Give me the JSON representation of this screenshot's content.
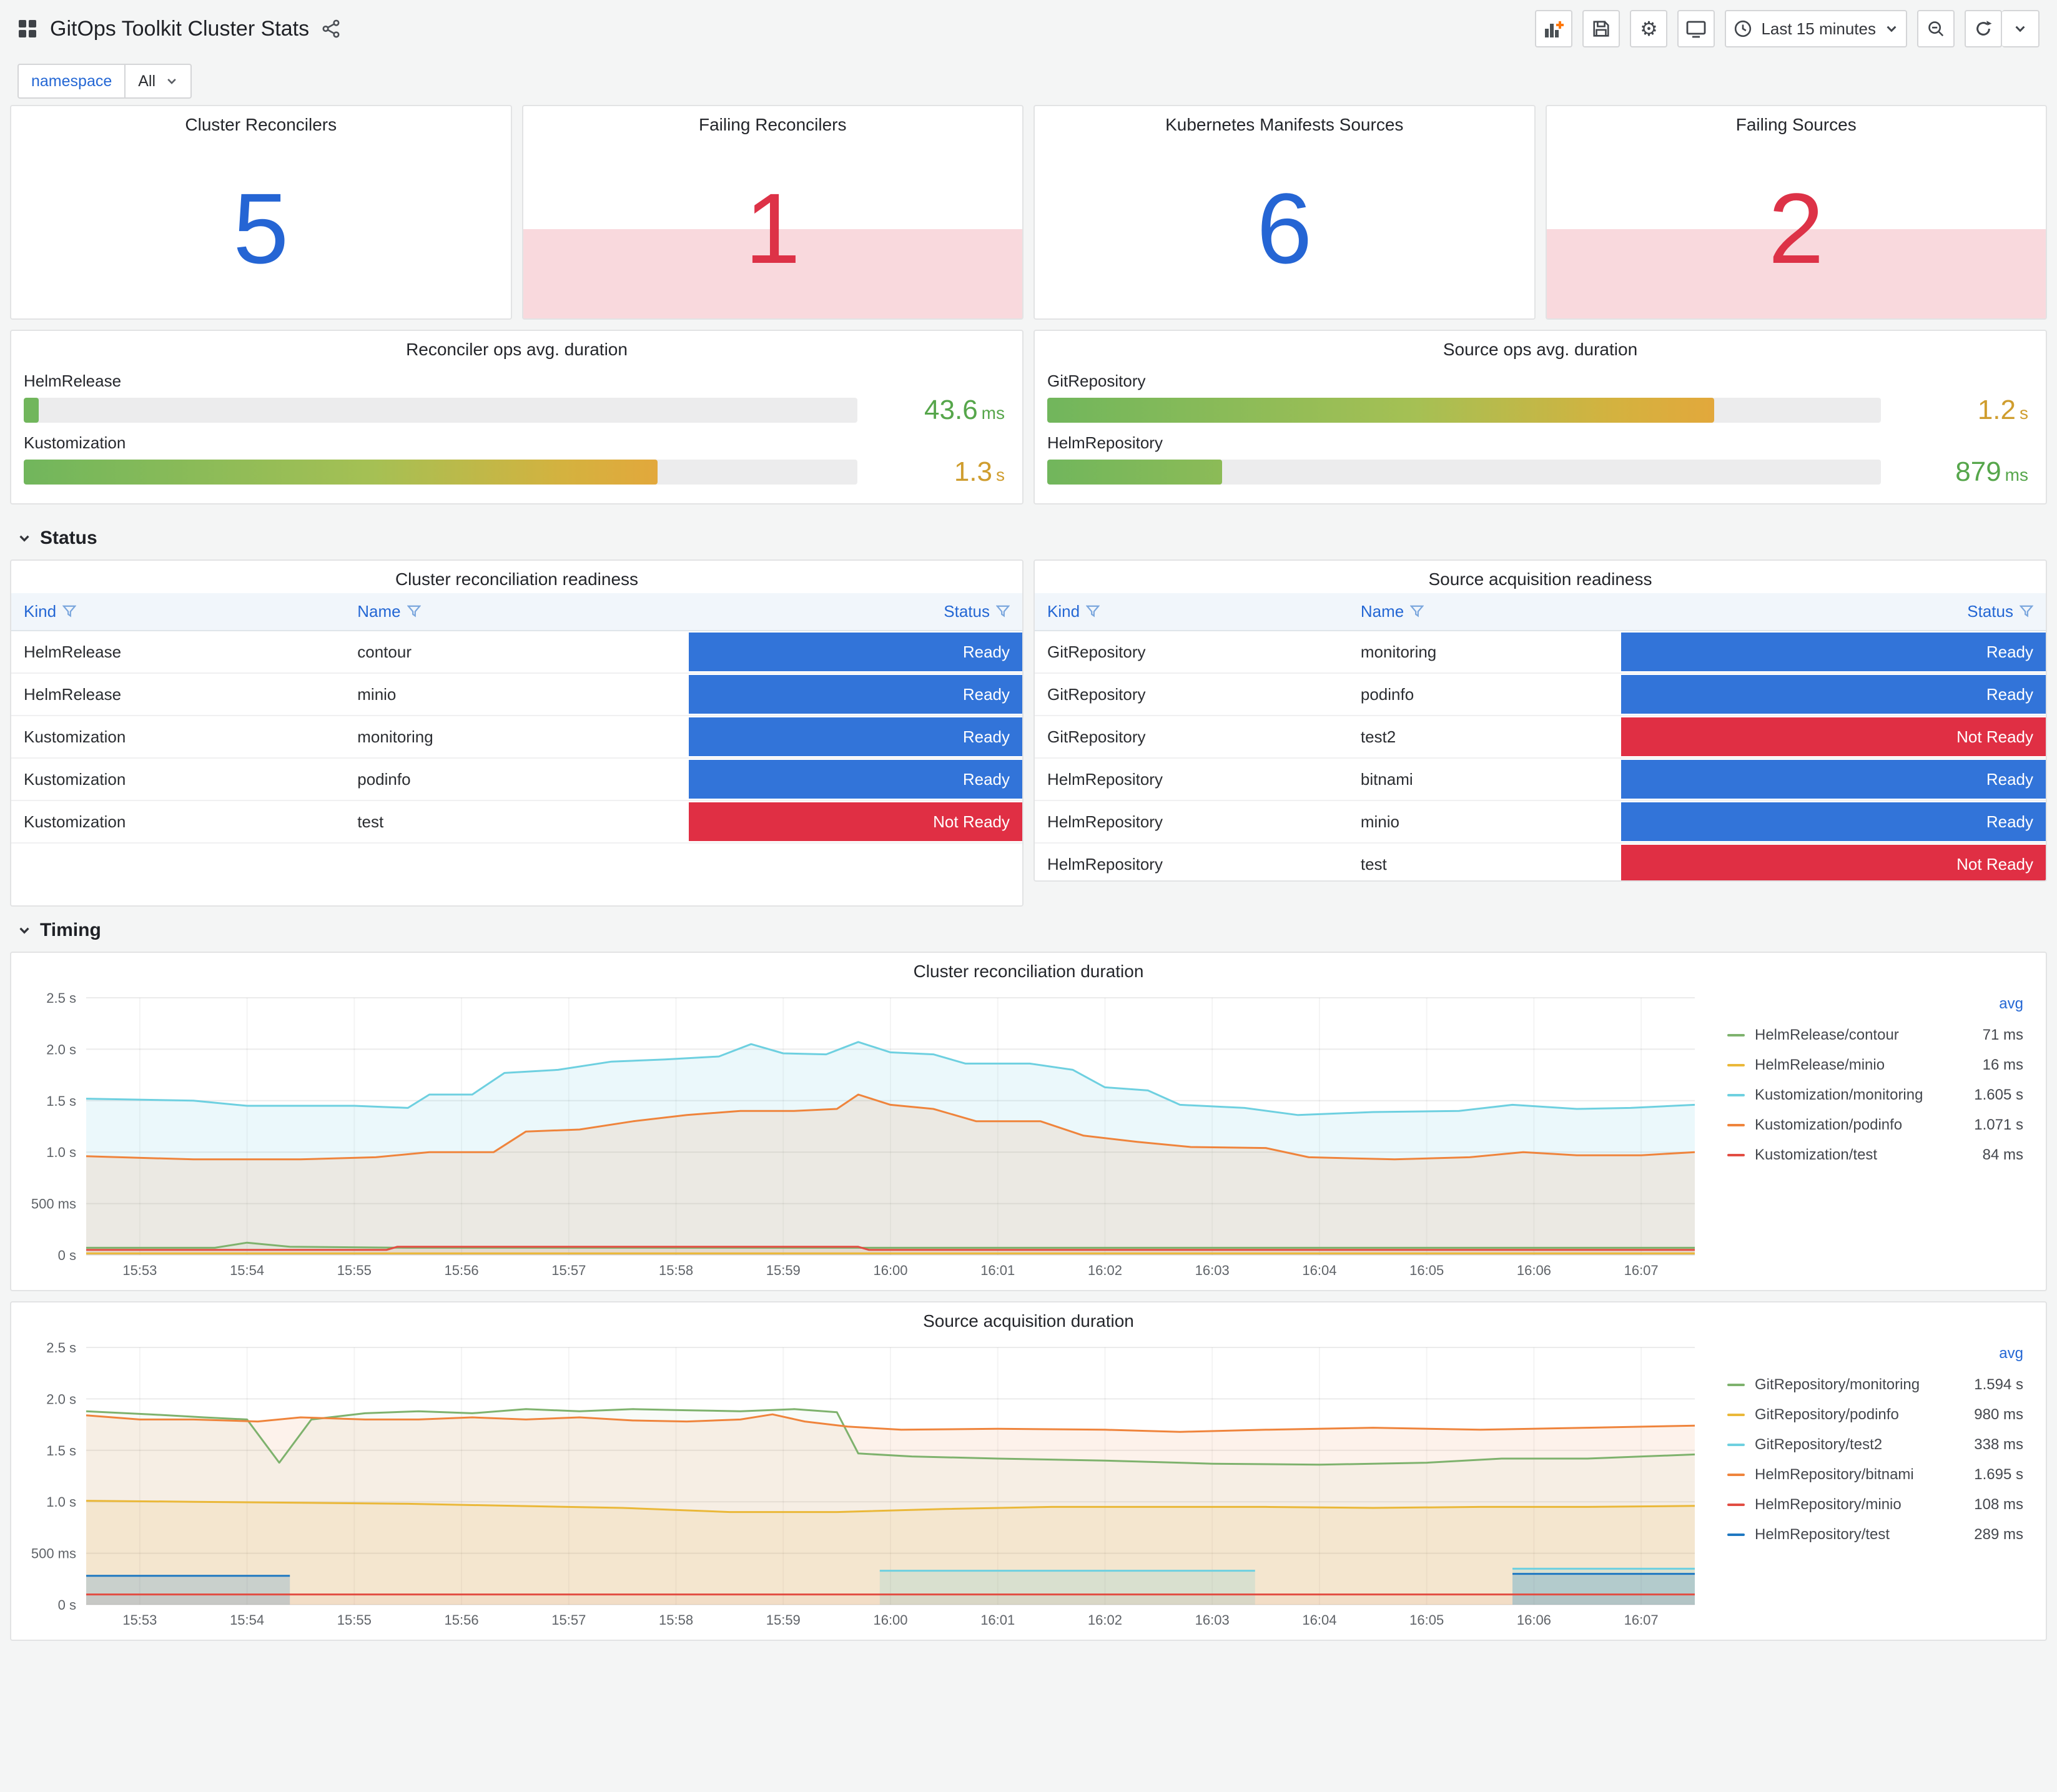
{
  "header": {
    "title": "GitOps Toolkit Cluster Stats",
    "time_label": "Last 15 minutes"
  },
  "filters": {
    "namespace_label": "namespace",
    "namespace_value": "All"
  },
  "sections": {
    "status": "Status",
    "timing": "Timing"
  },
  "stats": [
    {
      "title": "Cluster Reconcilers",
      "value": "5",
      "color": "#2565d4"
    },
    {
      "title": "Failing Reconcilers",
      "value": "1",
      "color": "#dd3247"
    },
    {
      "title": "Kubernetes Manifests Sources",
      "value": "6",
      "color": "#2565d4"
    },
    {
      "title": "Failing Sources",
      "value": "2",
      "color": "#dd3247"
    }
  ],
  "gauges": [
    {
      "title": "Reconciler ops avg. duration",
      "rows": [
        {
          "label": "HelmRelease",
          "value": "43.6",
          "unit": "ms",
          "width": "1.8%",
          "color": "#56a64b"
        },
        {
          "label": "Kustomization",
          "value": "1.3",
          "unit": "s",
          "width": "76%",
          "color": "#cf9d2e"
        }
      ]
    },
    {
      "title": "Source ops avg. duration",
      "rows": [
        {
          "label": "GitRepository",
          "value": "1.2",
          "unit": "s",
          "width": "80%",
          "color": "#cf9d2e"
        },
        {
          "label": "HelmRepository",
          "value": "879",
          "unit": "ms",
          "width": "21%",
          "color": "#56a64b"
        }
      ]
    }
  ],
  "status": {
    "tables": [
      {
        "title": "Cluster reconciliation readiness",
        "columns": [
          "Kind",
          "Name",
          "Status"
        ],
        "rows": [
          [
            "HelmRelease",
            "contour",
            "Ready"
          ],
          [
            "HelmRelease",
            "minio",
            "Ready"
          ],
          [
            "Kustomization",
            "monitoring",
            "Ready"
          ],
          [
            "Kustomization",
            "podinfo",
            "Ready"
          ],
          [
            "Kustomization",
            "test",
            "Not Ready"
          ]
        ]
      },
      {
        "title": "Source acquisition readiness",
        "columns": [
          "Kind",
          "Name",
          "Status"
        ],
        "rows": [
          [
            "GitRepository",
            "monitoring",
            "Ready"
          ],
          [
            "GitRepository",
            "podinfo",
            "Ready"
          ],
          [
            "GitRepository",
            "test2",
            "Not Ready"
          ],
          [
            "HelmRepository",
            "bitnami",
            "Ready"
          ],
          [
            "HelmRepository",
            "minio",
            "Ready"
          ],
          [
            "HelmRepository",
            "test",
            "Not Ready"
          ]
        ]
      }
    ]
  },
  "chart_data": [
    {
      "type": "line",
      "title": "Cluster reconciliation duration",
      "legend_header": "avg",
      "xlim": [
        0,
        15
      ],
      "ylim": [
        0,
        2.5
      ],
      "yticks": [
        {
          "v": 0,
          "label": "0 s"
        },
        {
          "v": 0.5,
          "label": "500 ms"
        },
        {
          "v": 1.0,
          "label": "1.0 s"
        },
        {
          "v": 1.5,
          "label": "1.5 s"
        },
        {
          "v": 2.0,
          "label": "2.0 s"
        },
        {
          "v": 2.5,
          "label": "2.5 s"
        }
      ],
      "xticks": [
        "15:53",
        "15:54",
        "15:55",
        "15:56",
        "15:57",
        "15:58",
        "15:59",
        "16:00",
        "16:01",
        "16:02",
        "16:03",
        "16:04",
        "16:05",
        "16:06",
        "16:07"
      ],
      "series": [
        {
          "name": "HelmRelease/contour",
          "avg": "71 ms",
          "color": "#7EB26D",
          "fill": 0.06,
          "points": [
            [
              0,
              0.07
            ],
            [
              1.2,
              0.07
            ],
            [
              1.5,
              0.12
            ],
            [
              1.9,
              0.08
            ],
            [
              3,
              0.07
            ],
            [
              15,
              0.07
            ]
          ]
        },
        {
          "name": "HelmRelease/minio",
          "avg": "16 ms",
          "color": "#EAB839",
          "fill": 0.04,
          "points": [
            [
              0,
              0.016
            ],
            [
              15,
              0.016
            ]
          ]
        },
        {
          "name": "Kustomization/monitoring",
          "avg": "1.605 s",
          "color": "#6ED0E0",
          "fill": 0.14,
          "points": [
            [
              0,
              1.52
            ],
            [
              1,
              1.5
            ],
            [
              1.5,
              1.45
            ],
            [
              2.5,
              1.45
            ],
            [
              3,
              1.43
            ],
            [
              3.2,
              1.56
            ],
            [
              3.6,
              1.56
            ],
            [
              3.9,
              1.77
            ],
            [
              4.4,
              1.8
            ],
            [
              4.9,
              1.88
            ],
            [
              5.4,
              1.9
            ],
            [
              5.9,
              1.93
            ],
            [
              6.2,
              2.05
            ],
            [
              6.5,
              1.96
            ],
            [
              6.9,
              1.95
            ],
            [
              7.2,
              2.07
            ],
            [
              7.5,
              1.97
            ],
            [
              7.9,
              1.95
            ],
            [
              8.2,
              1.86
            ],
            [
              8.8,
              1.86
            ],
            [
              9.2,
              1.8
            ],
            [
              9.5,
              1.63
            ],
            [
              9.9,
              1.6
            ],
            [
              10.2,
              1.46
            ],
            [
              10.8,
              1.43
            ],
            [
              11.3,
              1.36
            ],
            [
              12,
              1.39
            ],
            [
              12.8,
              1.4
            ],
            [
              13.3,
              1.46
            ],
            [
              13.9,
              1.42
            ],
            [
              14.4,
              1.43
            ],
            [
              15,
              1.46
            ]
          ]
        },
        {
          "name": "Kustomization/podinfo",
          "avg": "1.071 s",
          "color": "#EF843C",
          "fill": 0.12,
          "points": [
            [
              0,
              0.96
            ],
            [
              1,
              0.93
            ],
            [
              2,
              0.93
            ],
            [
              2.7,
              0.95
            ],
            [
              3.2,
              1.0
            ],
            [
              3.8,
              1.0
            ],
            [
              4.1,
              1.2
            ],
            [
              4.6,
              1.22
            ],
            [
              5.1,
              1.3
            ],
            [
              5.6,
              1.36
            ],
            [
              6.1,
              1.4
            ],
            [
              6.6,
              1.4
            ],
            [
              7,
              1.42
            ],
            [
              7.2,
              1.56
            ],
            [
              7.5,
              1.46
            ],
            [
              7.9,
              1.42
            ],
            [
              8.3,
              1.3
            ],
            [
              8.9,
              1.3
            ],
            [
              9.3,
              1.16
            ],
            [
              9.8,
              1.1
            ],
            [
              10.3,
              1.05
            ],
            [
              11,
              1.04
            ],
            [
              11.4,
              0.95
            ],
            [
              12.2,
              0.93
            ],
            [
              12.9,
              0.95
            ],
            [
              13.4,
              1.0
            ],
            [
              13.9,
              0.97
            ],
            [
              14.5,
              0.97
            ],
            [
              15,
              1.0
            ]
          ]
        },
        {
          "name": "Kustomization/test",
          "avg": "84 ms",
          "color": "#E24D42",
          "fill": 0.08,
          "points": [
            [
              0,
              0.05
            ],
            [
              2.8,
              0.05
            ],
            [
              2.9,
              0.08
            ],
            [
              7.2,
              0.08
            ],
            [
              7.3,
              0.05
            ],
            [
              15,
              0.05
            ]
          ]
        }
      ]
    },
    {
      "type": "line",
      "title": "Source acquisition duration",
      "legend_header": "avg",
      "xlim": [
        0,
        15
      ],
      "ylim": [
        0,
        2.5
      ],
      "yticks": [
        {
          "v": 0,
          "label": "0 s"
        },
        {
          "v": 0.5,
          "label": "500 ms"
        },
        {
          "v": 1.0,
          "label": "1.0 s"
        },
        {
          "v": 1.5,
          "label": "1.5 s"
        },
        {
          "v": 2.0,
          "label": "2.0 s"
        },
        {
          "v": 2.5,
          "label": "2.5 s"
        }
      ],
      "xticks": [
        "15:53",
        "15:54",
        "15:55",
        "15:56",
        "15:57",
        "15:58",
        "15:59",
        "16:00",
        "16:01",
        "16:02",
        "16:03",
        "16:04",
        "16:05",
        "16:06",
        "16:07"
      ],
      "series": [
        {
          "name": "GitRepository/monitoring",
          "avg": "1.594 s",
          "color": "#7EB26D",
          "fill": 0.05,
          "points": [
            [
              0,
              1.88
            ],
            [
              0.6,
              1.85
            ],
            [
              1.1,
              1.82
            ],
            [
              1.5,
              1.8
            ],
            [
              1.8,
              1.38
            ],
            [
              2.1,
              1.8
            ],
            [
              2.6,
              1.86
            ],
            [
              3.1,
              1.88
            ],
            [
              3.6,
              1.86
            ],
            [
              4.1,
              1.9
            ],
            [
              4.6,
              1.88
            ],
            [
              5.1,
              1.9
            ],
            [
              5.6,
              1.89
            ],
            [
              6.1,
              1.88
            ],
            [
              6.6,
              1.9
            ],
            [
              7,
              1.87
            ],
            [
              7.2,
              1.47
            ],
            [
              7.7,
              1.44
            ],
            [
              8.5,
              1.42
            ],
            [
              9.5,
              1.4
            ],
            [
              10.5,
              1.37
            ],
            [
              11.5,
              1.36
            ],
            [
              12.5,
              1.38
            ],
            [
              13.2,
              1.42
            ],
            [
              14,
              1.42
            ],
            [
              15,
              1.46
            ]
          ]
        },
        {
          "name": "GitRepository/podinfo",
          "avg": "980 ms",
          "color": "#EAB839",
          "fill": 0.12,
          "points": [
            [
              0,
              1.01
            ],
            [
              1,
              1.0
            ],
            [
              2,
              0.99
            ],
            [
              3,
              0.98
            ],
            [
              4,
              0.96
            ],
            [
              5,
              0.94
            ],
            [
              6,
              0.9
            ],
            [
              7,
              0.9
            ],
            [
              8,
              0.93
            ],
            [
              9,
              0.95
            ],
            [
              10,
              0.95
            ],
            [
              11,
              0.95
            ],
            [
              12,
              0.94
            ],
            [
              13,
              0.95
            ],
            [
              14,
              0.95
            ],
            [
              15,
              0.96
            ]
          ]
        },
        {
          "name": "GitRepository/test2",
          "avg": "338 ms",
          "color": "#6ED0E0",
          "fill": 0.22,
          "points": [
            [
              7.4,
              0.33
            ],
            [
              10.9,
              0.33
            ],
            [
              11,
              null
            ],
            [
              13.3,
              0.35
            ],
            [
              15,
              0.35
            ]
          ]
        },
        {
          "name": "HelmRepository/bitnami",
          "avg": "1.695 s",
          "color": "#EF843C",
          "fill": 0.1,
          "points": [
            [
              0,
              1.84
            ],
            [
              0.5,
              1.8
            ],
            [
              1,
              1.8
            ],
            [
              1.6,
              1.78
            ],
            [
              2,
              1.82
            ],
            [
              2.6,
              1.8
            ],
            [
              3.1,
              1.8
            ],
            [
              3.6,
              1.82
            ],
            [
              4.1,
              1.8
            ],
            [
              4.6,
              1.82
            ],
            [
              5.1,
              1.79
            ],
            [
              5.6,
              1.78
            ],
            [
              6.1,
              1.8
            ],
            [
              6.4,
              1.85
            ],
            [
              6.7,
              1.78
            ],
            [
              7.1,
              1.73
            ],
            [
              7.6,
              1.7
            ],
            [
              8.5,
              1.71
            ],
            [
              9.5,
              1.7
            ],
            [
              10.2,
              1.68
            ],
            [
              11,
              1.7
            ],
            [
              12,
              1.72
            ],
            [
              13,
              1.7
            ],
            [
              14,
              1.72
            ],
            [
              15,
              1.74
            ]
          ]
        },
        {
          "name": "HelmRepository/minio",
          "avg": "108 ms",
          "color": "#E24D42",
          "fill": 0.06,
          "points": [
            [
              0,
              0.1
            ],
            [
              15,
              0.1
            ]
          ]
        },
        {
          "name": "HelmRepository/test",
          "avg": "289 ms",
          "color": "#1F78C1",
          "fill": 0.2,
          "points": [
            [
              0,
              0.28
            ],
            [
              1.9,
              0.28
            ],
            [
              2,
              null
            ],
            [
              13.3,
              0.3
            ],
            [
              15,
              0.3
            ]
          ]
        }
      ]
    }
  ]
}
